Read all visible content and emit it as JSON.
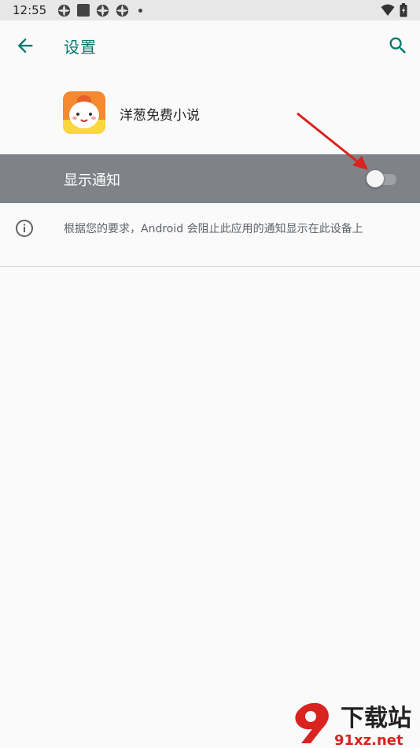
{
  "status_bar": {
    "time": "12:55"
  },
  "app_bar": {
    "title": "设置"
  },
  "app_info": {
    "name": "洋葱免费小说"
  },
  "notification": {
    "label": "显示通知",
    "enabled": false
  },
  "info": {
    "text": "根据您的要求，Android 会阻止此应用的通知显示在此设备上"
  },
  "watermark": {
    "text_top": "下载站",
    "text_bottom": "91xz.net"
  },
  "colors": {
    "accent": "#00796b",
    "row_highlight": "#7f8389",
    "annotation_arrow": "#d8231f"
  },
  "icons": [
    "arrow-back-icon",
    "search-icon",
    "info-icon",
    "wifi-icon",
    "battery-icon"
  ]
}
